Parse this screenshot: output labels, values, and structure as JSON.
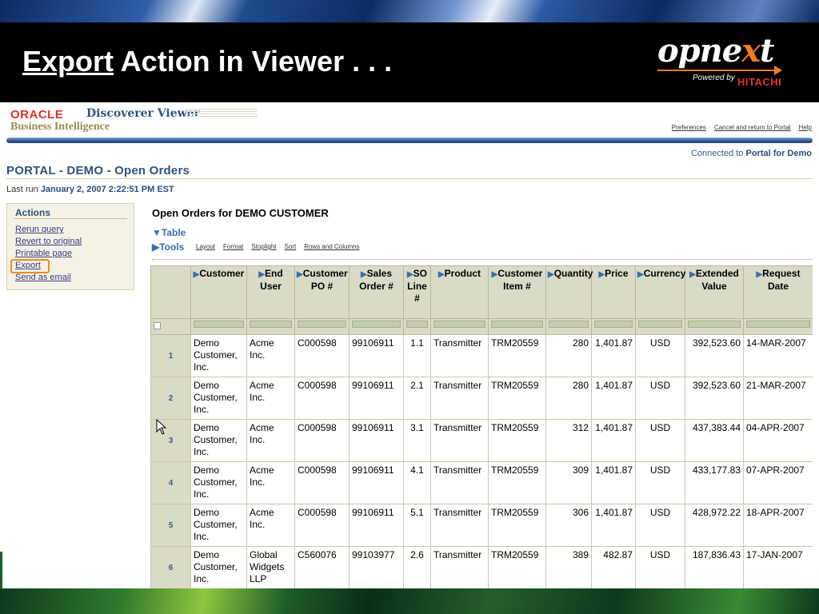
{
  "slide": {
    "title_underlined": "Export",
    "title_rest": " Action in Viewer . . .",
    "logo": {
      "word_a": "opne",
      "word_x": "x",
      "word_b": "t",
      "powered": "Powered by",
      "brand": "HITACHI"
    }
  },
  "app": {
    "oracle": "ORACLE",
    "product": "Discoverer Viewer",
    "subtitle": "Business Intelligence",
    "global_links": [
      "Preferences",
      "Cancel and return to Portal",
      "Help"
    ],
    "connected_prefix": "Connected to",
    "connected_target": "Portal for Demo",
    "page_title": "PORTAL - DEMO - Open Orders",
    "last_run_prefix": "Last run",
    "last_run_value": "January 2, 2007 2:22:51 PM EST"
  },
  "actions": {
    "title": "Actions",
    "items": [
      "Rerun query",
      "Revert to original",
      "Printable page",
      "Export",
      "Send as email"
    ]
  },
  "report": {
    "title": "Open Orders for DEMO CUSTOMER",
    "table_label": "Table",
    "tools_label": "Tools",
    "tool_links": [
      "Layout",
      "Format",
      "Stoplight",
      "Sort",
      "Rows and Columns"
    ],
    "columns": [
      "Customer",
      "End User",
      "Customer PO #",
      "Sales Order #",
      "SO Line #",
      "Product",
      "Customer Item #",
      "Quantity",
      "Price",
      "Currency",
      "Extended Value",
      "Request Date"
    ],
    "rows": [
      {
        "n": "1",
        "cells": [
          "Demo Customer, Inc.",
          "Acme Inc.",
          "C000598",
          "99106911",
          "1.1",
          "Transmitter",
          "TRM20559",
          "280",
          "1,401.87",
          "USD",
          "392,523.60",
          "14-MAR-2007"
        ]
      },
      {
        "n": "2",
        "cells": [
          "Demo Customer, Inc.",
          "Acme Inc.",
          "C000598",
          "99106911",
          "2.1",
          "Transmitter",
          "TRM20559",
          "280",
          "1,401.87",
          "USD",
          "392,523.60",
          "21-MAR-2007"
        ]
      },
      {
        "n": "3",
        "cells": [
          "Demo Customer, Inc.",
          "Acme Inc.",
          "C000598",
          "99106911",
          "3.1",
          "Transmitter",
          "TRM20559",
          "312",
          "1,401.87",
          "USD",
          "437,383.44",
          "04-APR-2007"
        ]
      },
      {
        "n": "4",
        "cells": [
          "Demo Customer, Inc.",
          "Acme Inc.",
          "C000598",
          "99106911",
          "4.1",
          "Transmitter",
          "TRM20559",
          "309",
          "1,401.87",
          "USD",
          "433,177.83",
          "07-APR-2007"
        ]
      },
      {
        "n": "5",
        "cells": [
          "Demo Customer, Inc.",
          "Acme Inc.",
          "C000598",
          "99106911",
          "5.1",
          "Transmitter",
          "TRM20559",
          "306",
          "1,401.87",
          "USD",
          "428,972.22",
          "18-APR-2007"
        ]
      },
      {
        "n": "6",
        "cells": [
          "Demo Customer, Inc.",
          "Global Widgets LLP",
          "C560076",
          "99103977",
          "2.6",
          "Transmitter",
          "TRM20559",
          "389",
          "482.87",
          "USD",
          "187,836.43",
          "17-JAN-2007"
        ]
      }
    ]
  },
  "colors": {
    "accent_orange": "#f08a1c",
    "oracle_red": "#e0322b",
    "header_blue": "#31517f"
  }
}
